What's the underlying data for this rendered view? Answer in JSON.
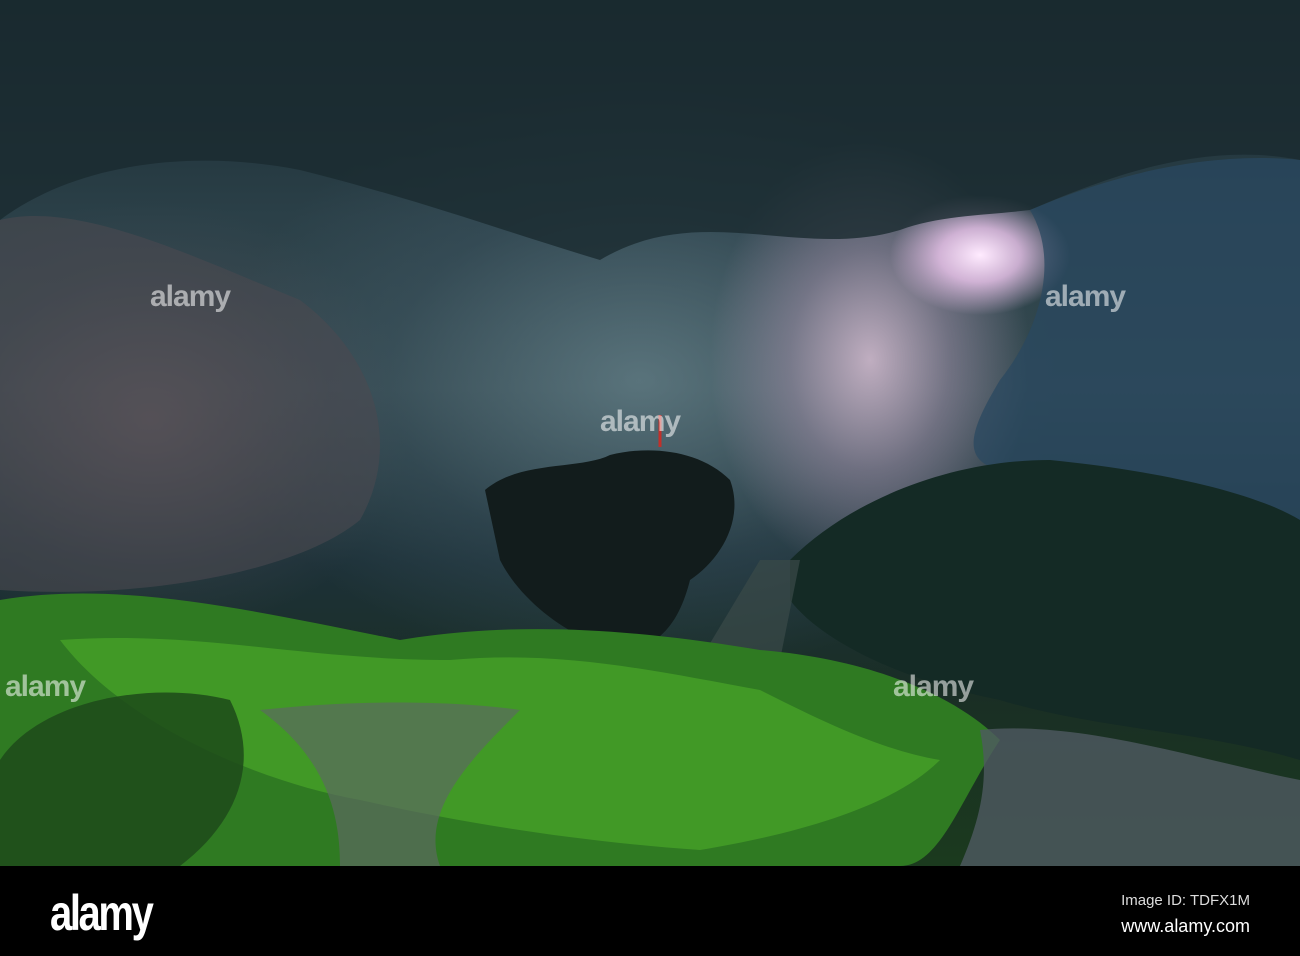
{
  "photo": {
    "subject": "Cave interior with light opening and green vegetation"
  },
  "watermark": {
    "text": "alamy"
  },
  "footer": {
    "logo": "alamy",
    "image_id": "Image ID: TDFX1M",
    "url": "www.alamy.com"
  }
}
